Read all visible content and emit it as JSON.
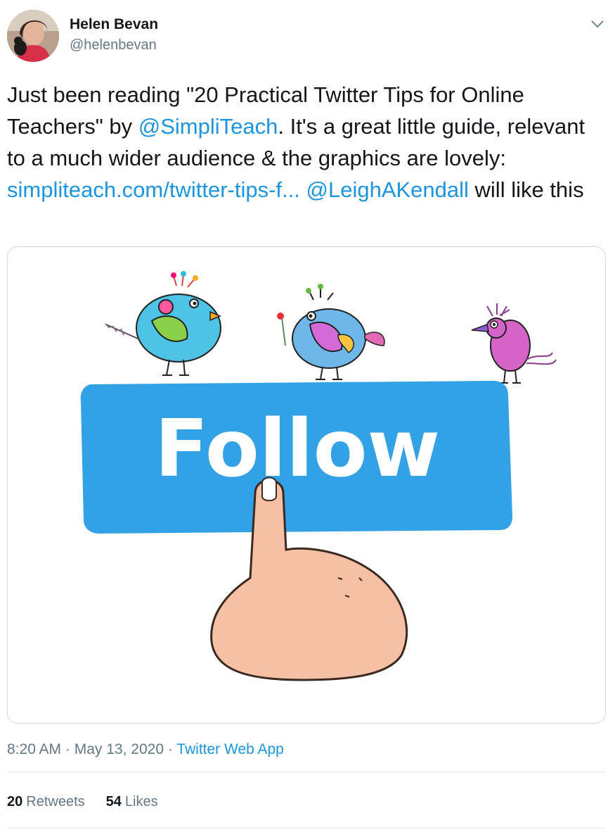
{
  "author": {
    "name": "Helen Bevan",
    "handle": "@helenbevan"
  },
  "tweet": {
    "text_parts": [
      {
        "text": "Just been reading \"20 Practical Twitter Tips for Online Teachers\" by ",
        "type": "text"
      },
      {
        "text": "@SimpliTeach",
        "type": "mention"
      },
      {
        "text": ". It's a great little guide, relevant to a much wider audience & the graphics are lovely: ",
        "type": "text"
      },
      {
        "text": "simpliteach.com/twitter-tips-f...",
        "type": "url"
      },
      {
        "text": " ",
        "type": "text"
      },
      {
        "text": "@LeighAKendall",
        "type": "mention"
      },
      {
        "text": " will like this",
        "type": "text"
      }
    ]
  },
  "media": {
    "button_text": "Follow"
  },
  "meta": {
    "time": "8:20 AM",
    "separator": "·",
    "date": "May 13, 2020",
    "source": "Twitter Web App"
  },
  "stats": {
    "retweets_count": "20",
    "retweets_label": "Retweets",
    "likes_count": "54",
    "likes_label": "Likes"
  },
  "colors": {
    "link": "#1b95e0",
    "muted": "#657786",
    "follow_button": "#33a1e6"
  },
  "icons": [
    "chevron-down-icon"
  ]
}
